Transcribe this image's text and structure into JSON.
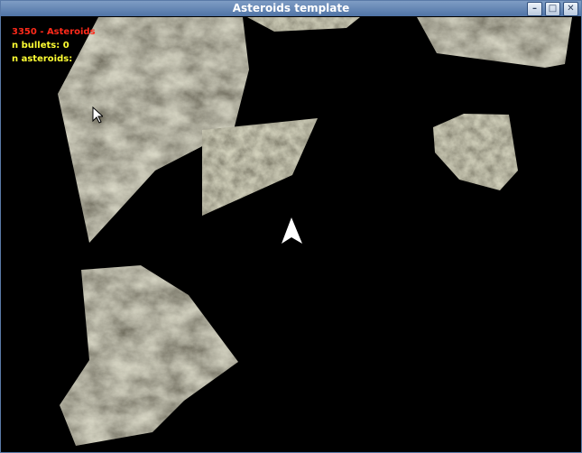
{
  "window": {
    "title": "Asteroids template",
    "controls": [
      "minimize",
      "maximize",
      "close"
    ]
  },
  "hud": {
    "title_line": "3350 - Asteroids",
    "bullets_line": "n bullets: 0",
    "asteroids_line": "n asteroids:"
  },
  "colors": {
    "background": "#000000",
    "hud_title": "#ff2a1a",
    "hud_stats": "#ffff33",
    "ship": "#ffffff",
    "asteroid_texture": "#7a7560"
  },
  "scene": {
    "ship": "player-ship",
    "asteroid_count_visible": 6,
    "cursor": "mouse-pointer"
  }
}
